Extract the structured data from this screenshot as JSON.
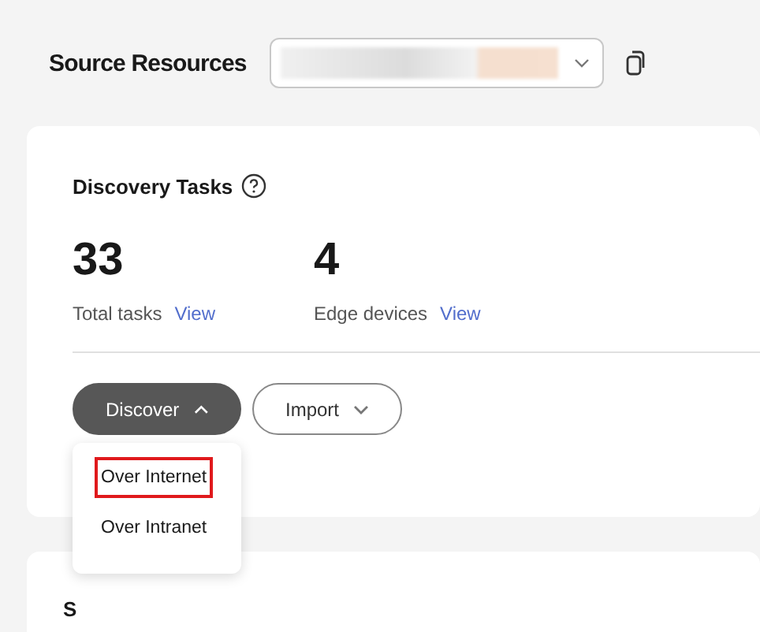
{
  "header": {
    "title": "Source Resources",
    "select": {
      "value_blurred": true
    }
  },
  "discovery": {
    "title": "Discovery Tasks",
    "stats": [
      {
        "value": "33",
        "label": "Total tasks",
        "link": "View"
      },
      {
        "value": "4",
        "label": "Edge devices",
        "link": "View"
      }
    ],
    "buttons": [
      {
        "label": "Discover",
        "kind": "primary",
        "expanded": true
      },
      {
        "label": "Import",
        "kind": "secondary",
        "expanded": false
      }
    ],
    "menu": [
      {
        "label": "Over Internet",
        "highlighted": true
      },
      {
        "label": "Over Intranet",
        "highlighted": false
      }
    ]
  },
  "next_section": {
    "title": "S"
  }
}
